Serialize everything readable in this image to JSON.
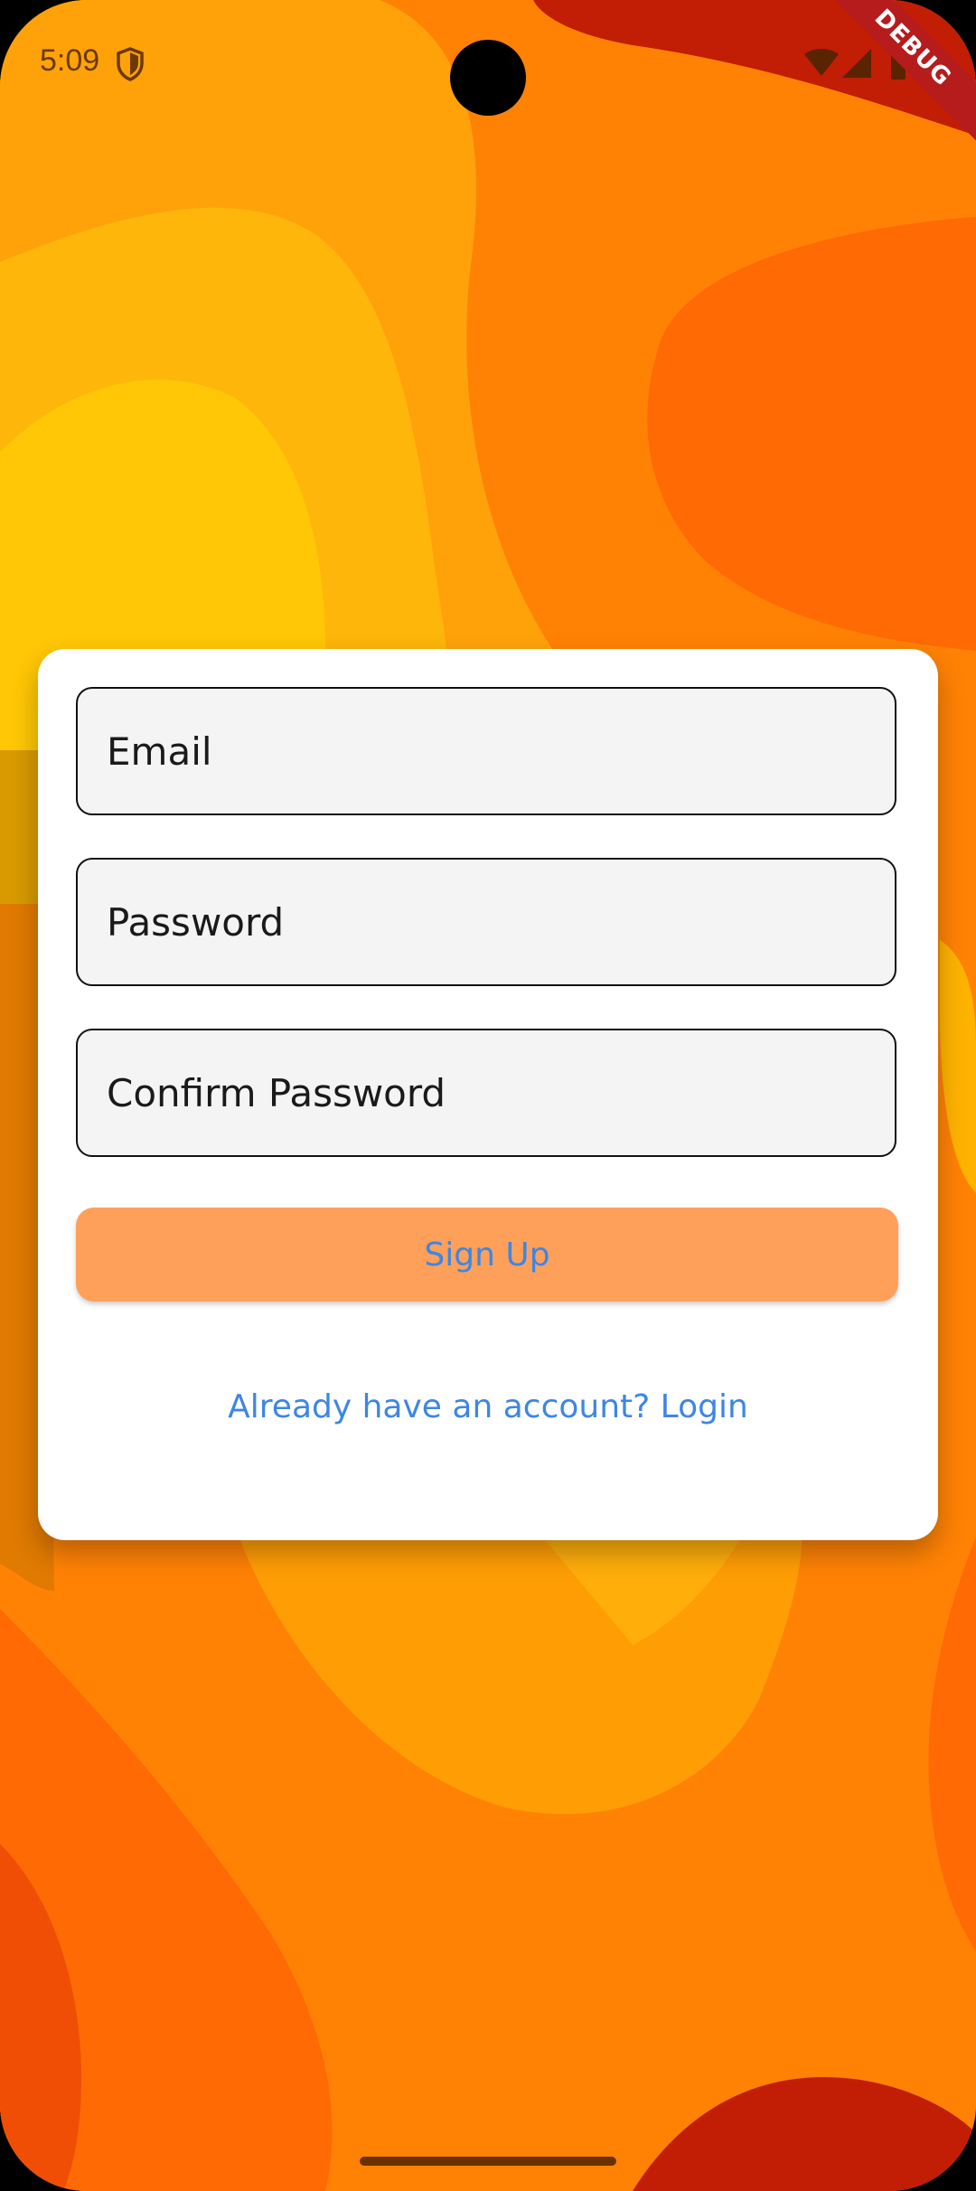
{
  "status_bar": {
    "time": "5:09",
    "shield_icon": "shield-icon",
    "wifi_icon": "wifi-icon",
    "signal_icon": "signal-icon",
    "battery_icon": "battery-icon"
  },
  "debug_banner": "DEBUG",
  "form": {
    "email_placeholder": "Email",
    "password_placeholder": "Password",
    "confirm_password_placeholder": "Confirm Password",
    "signup_label": "Sign Up",
    "login_link": "Already have an account? Login"
  },
  "colors": {
    "background": "#ff8205",
    "card": "#ffffff",
    "button": "#ffa05a",
    "link": "#3d86e6",
    "debug_banner": "#b71c1c"
  }
}
